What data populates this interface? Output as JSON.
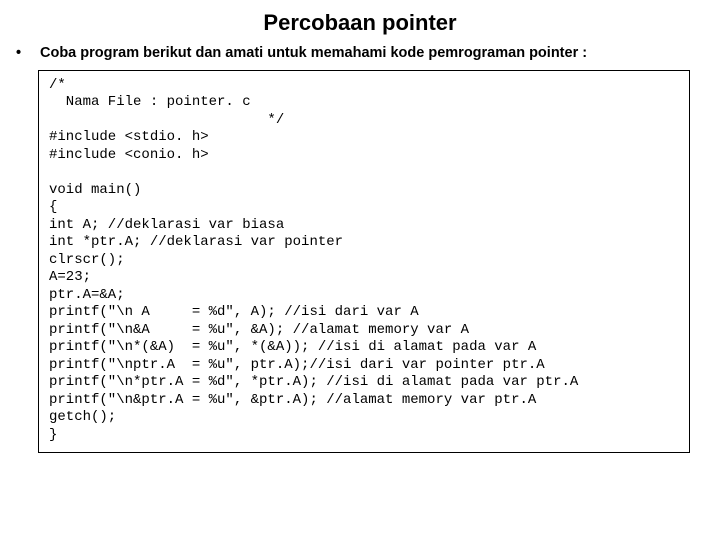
{
  "title": "Percobaan pointer",
  "bullet": "Coba program berikut dan amati untuk memahami kode pemrograman pointer :",
  "code": "/*\n  Nama File : pointer. c\n                          */\n#include <stdio. h>\n#include <conio. h>\n\nvoid main()\n{\nint A; //deklarasi var biasa\nint *ptr.A; //deklarasi var pointer\nclrscr();\nA=23;\nptr.A=&A;\nprintf(\"\\n A     = %d\", A); //isi dari var A\nprintf(\"\\n&A     = %u\", &A); //alamat memory var A\nprintf(\"\\n*(&A)  = %u\", *(&A)); //isi di alamat pada var A\nprintf(\"\\nptr.A  = %u\", ptr.A);//isi dari var pointer ptr.A\nprintf(\"\\n*ptr.A = %d\", *ptr.A); //isi di alamat pada var ptr.A\nprintf(\"\\n&ptr.A = %u\", &ptr.A); //alamat memory var ptr.A\ngetch();\n}"
}
